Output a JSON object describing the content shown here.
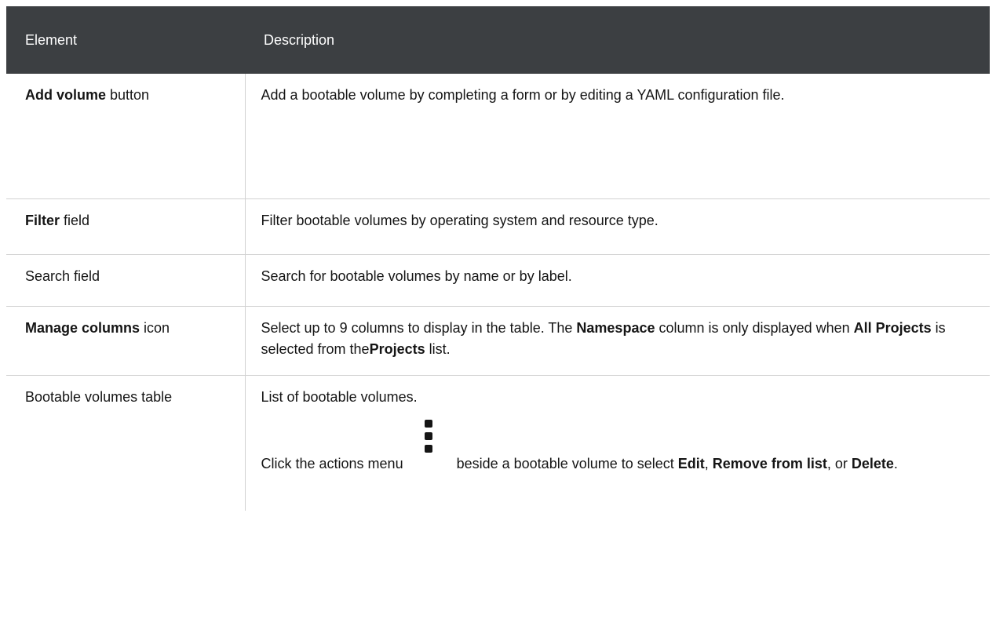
{
  "header": {
    "col_element": "Element",
    "col_description": "Description"
  },
  "rows": [
    {
      "element_bold": "Add volume",
      "element_rest": " button",
      "description": "Add a bootable volume by completing a form or by editing a YAML configuration file."
    },
    {
      "element_bold": "Filter",
      "element_rest": " field",
      "description": "Filter bootable volumes by operating system and resource type."
    },
    {
      "element": "Search field",
      "description": "Search for bootable volumes by name or by label."
    },
    {
      "element_bold": "Manage columns",
      "element_rest": " icon",
      "desc_parts": {
        "p1": "Select up to 9 columns to display in the table. The ",
        "b1": "Namespace",
        "p2": " column is only displayed when ",
        "b2": "All Projects",
        "p3": " is selected from the",
        "b3": "Projects",
        "p4": " list."
      }
    },
    {
      "element": "Bootable volumes table",
      "description_line1": "List of bootable volumes.",
      "desc2": {
        "p1": "Click the actions menu",
        "icon": "kebab-icon",
        "p2": "beside a bootable volume to select ",
        "b1": "Edit",
        "p3": ", ",
        "b2": "Remove from list",
        "p4": ", or ",
        "b3": "Delete",
        "p5": "."
      }
    }
  ],
  "colors": {
    "header_bg": "#3c3f42",
    "header_text": "#ffffff",
    "border": "#d2d2d2",
    "text": "#151515"
  }
}
